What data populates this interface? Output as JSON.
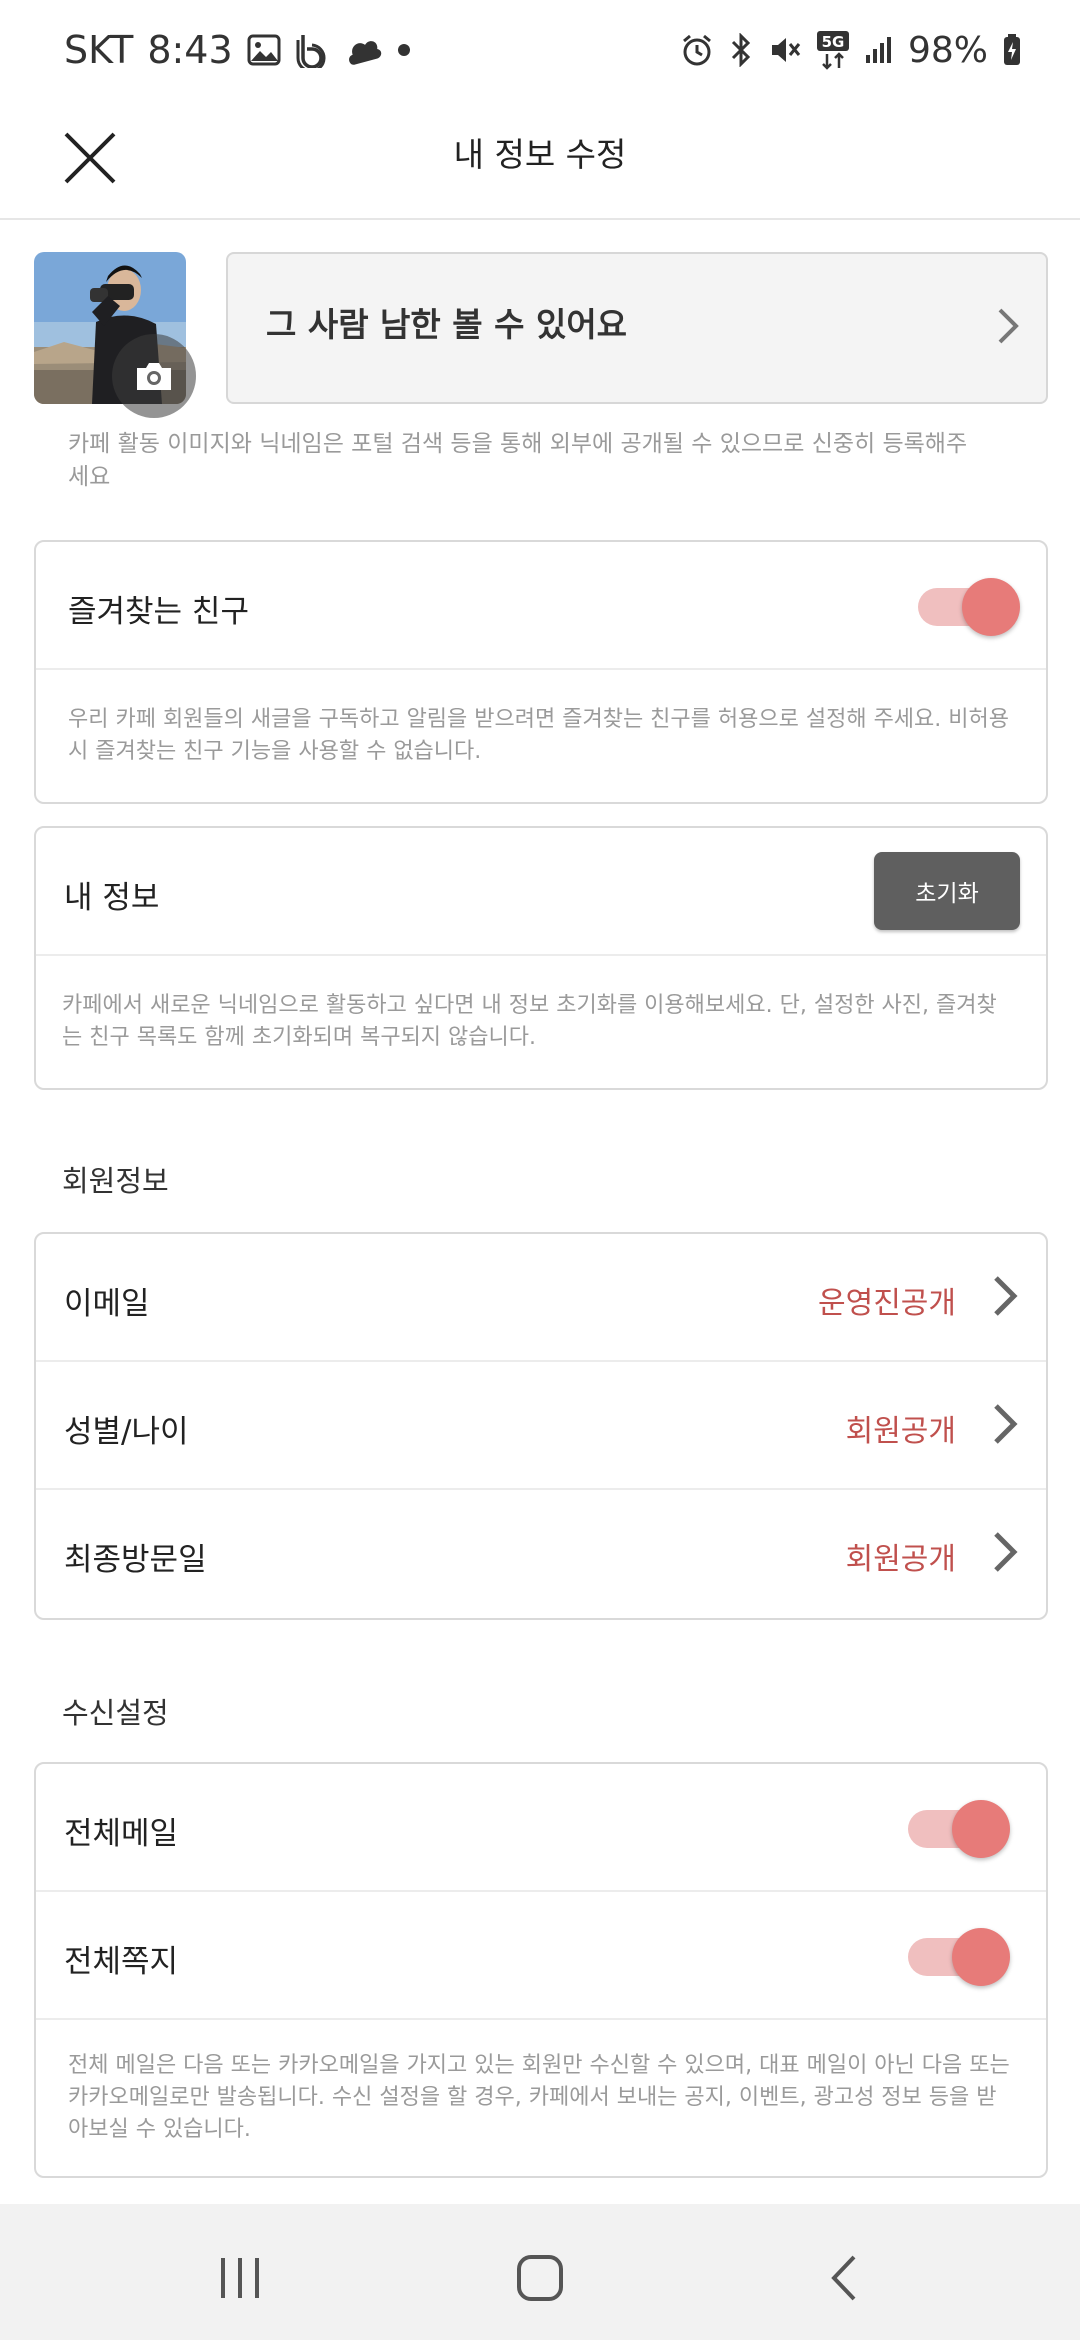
{
  "status_bar": {
    "carrier": "SKT",
    "time": "8:43",
    "battery": "98%",
    "network": "5G",
    "left_icons": [
      "gallery-icon",
      "b-app-icon",
      "cloud-icon",
      "dot-icon"
    ],
    "right_icons": [
      "alarm-icon",
      "bluetooth-icon",
      "mute-icon",
      "5g-icon",
      "signal-icon",
      "battery-icon"
    ]
  },
  "header": {
    "title": "내 정보 수정",
    "close_icon": "close-icon"
  },
  "profile": {
    "nickname": "그 사람 남한 볼 수 있어요",
    "notice": "카페 활동 이미지와 닉네임은 포털 검색 등을 통해 외부에 공개될 수 있으므로 신중히 등록해주세요"
  },
  "favorite_friend": {
    "label": "즐겨찾는 친구",
    "enabled": true,
    "note": "우리 카페 회원들의 새글을 구독하고 알림을 받으려면 즐겨찾는 친구를 허용으로 설정해 주세요. 비허용시 즐겨찾는 친구 기능을 사용할 수 없습니다."
  },
  "my_info": {
    "label": "내 정보",
    "reset_label": "초기화",
    "note": "카페에서 새로운 닉네임으로 활동하고 싶다면 내 정보 초기화를 이용해보세요. 단, 설정한 사진, 즐겨찾는 친구 목록도 함께 초기화되며 복구되지 않습니다."
  },
  "member_info": {
    "section_title": "회원정보",
    "rows": [
      {
        "label": "이메일",
        "value": "운영진공개"
      },
      {
        "label": "성별/나이",
        "value": "회원공개"
      },
      {
        "label": "최종방문일",
        "value": "회원공개"
      }
    ]
  },
  "receive_settings": {
    "section_title": "수신설정",
    "rows": [
      {
        "label": "전체메일",
        "enabled": true
      },
      {
        "label": "전체쪽지",
        "enabled": true
      }
    ],
    "note": "전체 메일은 다음 또는 카카오메일을 가지고 있는 회원만 수신할 수 있으며, 대표 메일이 아닌 다음 또는 카카오메일로만 발송됩니다. 수신 설정을 할 경우, 카페에서 보내는 공지, 이벤트, 광고성 정보 등을 받아보실 수 있습니다."
  },
  "colors": {
    "accent": "#e77b79",
    "accent_light": "#f0bfbf",
    "privacy_text": "#c0504d",
    "reset_button": "#5f5f5f"
  },
  "nav_bar": {
    "icons": [
      "recent-apps-icon",
      "home-icon",
      "back-icon"
    ]
  }
}
